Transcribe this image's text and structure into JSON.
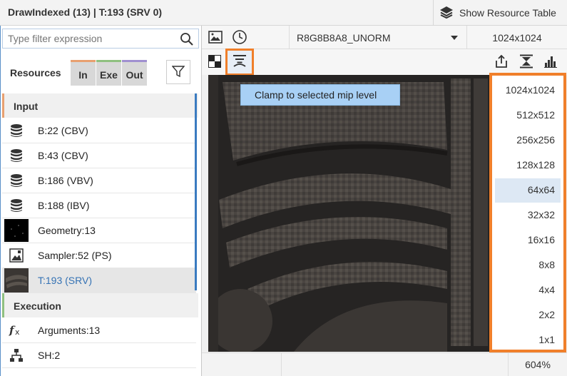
{
  "title": "DrawIndexed (13) | T:193 (SRV 0)",
  "show_resource_table": "Show Resource Table",
  "filter": {
    "placeholder": "Type filter expression"
  },
  "resources_label": "Resources",
  "tabs": {
    "in": "In",
    "exe": "Exe",
    "out": "Out"
  },
  "sections": {
    "input": "Input",
    "execution": "Execution"
  },
  "input_items": [
    {
      "label": "B:22 (CBV)",
      "icon": "buffer-icon"
    },
    {
      "label": "B:43 (CBV)",
      "icon": "buffer-icon"
    },
    {
      "label": "B:186 (VBV)",
      "icon": "buffer-icon"
    },
    {
      "label": "B:188 (IBV)",
      "icon": "buffer-icon"
    },
    {
      "label": "Geometry:13",
      "icon": "geometry-thumbnail-icon"
    },
    {
      "label": "Sampler:52 (PS)",
      "icon": "sampler-icon"
    },
    {
      "label": "T:193 (SRV)",
      "icon": "texture-thumbnail-icon",
      "selected": true
    }
  ],
  "execution_items": [
    {
      "label": "Arguments:13",
      "icon": "function-icon"
    },
    {
      "label": "SH:2",
      "icon": "shader-hierarchy-icon"
    }
  ],
  "toolbar": {
    "format": "R8G8B8A8_UNORM",
    "size": "1024x1024"
  },
  "tooltip": "Clamp to selected mip level",
  "mips": [
    "1024x1024",
    "512x512",
    "256x256",
    "128x128",
    "64x64",
    "32x32",
    "16x16",
    "8x8",
    "4x4",
    "2x2",
    "1x1"
  ],
  "selected_mip": "64x64",
  "zoom": "604%",
  "colors": {
    "accent_orange": "#f07f2a",
    "selection_blue": "#3472b4",
    "tooltip_bg": "#a8d0f5"
  }
}
